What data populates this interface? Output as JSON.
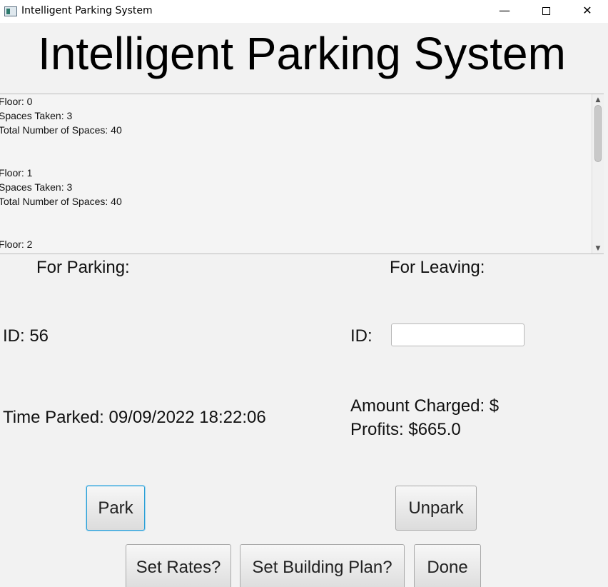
{
  "window": {
    "title": "Intelligent Parking System",
    "controls": {
      "minimize": "—",
      "close": "✕"
    }
  },
  "header": {
    "title": "Intelligent Parking System"
  },
  "floors_status": {
    "lines": [
      "Floor: 0",
      "Spaces Taken: 3",
      "Total Number of Spaces: 40",
      "Floor: 1",
      "Spaces Taken: 3",
      "Total Number of Spaces: 40",
      "Floor: 2"
    ],
    "scroll_up_icon": "▲",
    "scroll_down_icon": "▼"
  },
  "parking": {
    "heading": "For Parking:",
    "id_text": "ID: 56",
    "time_text": "Time Parked: 09/09/2022 18:22:06"
  },
  "leaving": {
    "heading": "For Leaving:",
    "id_label": "ID:",
    "id_value": "",
    "amount_text": "Amount Charged: $",
    "profits_text": "Profits: $665.0"
  },
  "buttons": {
    "park": "Park",
    "unpark": "Unpark",
    "set_rates": "Set Rates?",
    "set_building_plan": "Set Building Plan?",
    "done": "Done"
  },
  "colors": {
    "focus_accent": "#2a9fd6",
    "window_bg": "#f2f2f2"
  }
}
